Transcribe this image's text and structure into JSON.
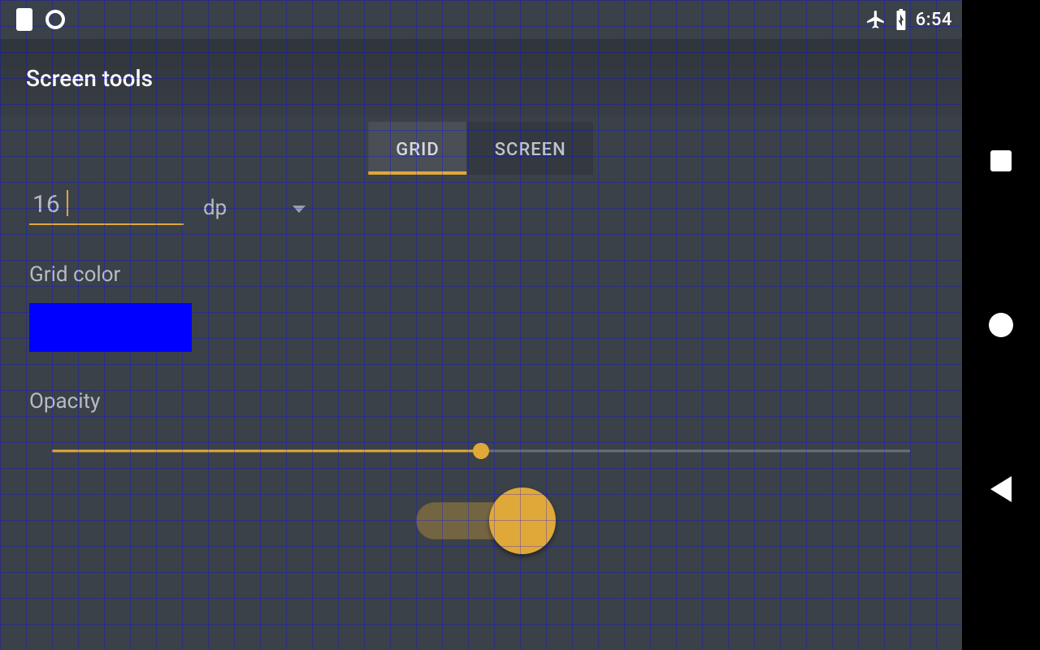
{
  "status_bar": {
    "time": "6:54"
  },
  "app": {
    "title": "Screen tools"
  },
  "tabs": {
    "grid": "GRID",
    "screen": "SCREEN",
    "active": "grid"
  },
  "grid_settings": {
    "size_value": "16",
    "unit_selected": "dp",
    "color_label": "Grid color",
    "color_value": "#0000ff",
    "opacity_label": "Opacity",
    "opacity_percent": 50,
    "enabled": true
  },
  "accent_color": "#e0a838",
  "nav": {
    "recent": "recent-apps",
    "home": "home",
    "back": "back"
  }
}
